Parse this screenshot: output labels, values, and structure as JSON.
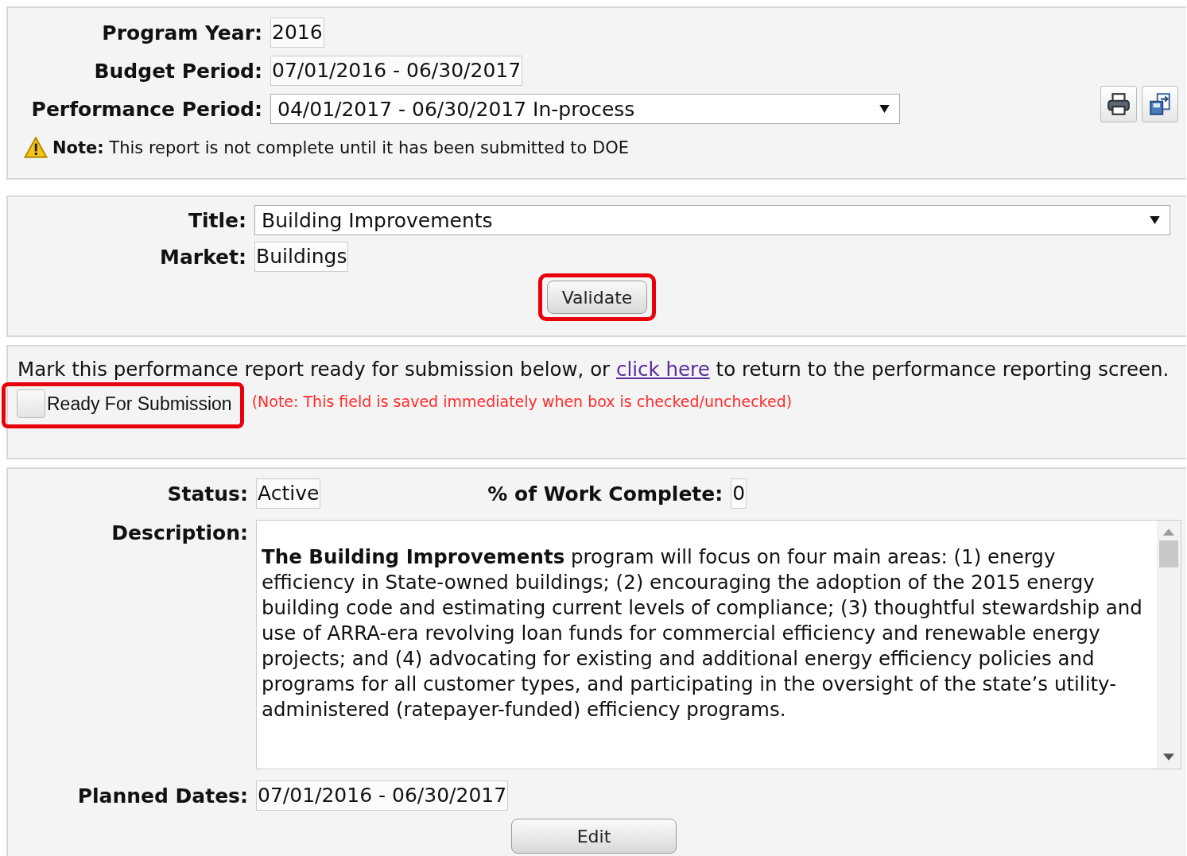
{
  "header": {
    "fields": [
      {
        "label": "Program Year:",
        "value": "2016",
        "kind": "text"
      },
      {
        "label": "Budget Period:",
        "value": "07/01/2016 - 06/30/2017",
        "kind": "text"
      },
      {
        "label": "Performance Period:",
        "value": "04/01/2017 - 06/30/2017 In-process",
        "kind": "select"
      }
    ],
    "note": {
      "label": "Note:",
      "text": "This report is not complete until it has been submitted to DOE"
    }
  },
  "program": {
    "fields": [
      {
        "label": "Title:",
        "value": "Building Improvements",
        "kind": "select"
      },
      {
        "label": "Market:",
        "value": "Buildings",
        "kind": "text"
      }
    ],
    "validate_button": {
      "label": "Validate",
      "highlighted": true
    }
  },
  "submission": {
    "text_before": "Mark this performance report ready for submission below, or ",
    "link": "click here",
    "text_after": " to return to the performance reporting screen.",
    "checkbox": {
      "label": "Ready For Submission",
      "checked": false,
      "highlighted": true
    },
    "note": "(Note: This field is saved immediately when box is checked/unchecked)"
  },
  "details": {
    "status_label": "Status:",
    "status": "Active",
    "percent_label": "% of Work Complete:",
    "percent": "0",
    "description_label": "Description:",
    "description": "**The Building Improvements** program will focus on four main areas: (1) energy efficiency in State-owned buildings; (2) encouraging the adoption of the 2015 energy building code and estimating current levels of compliance; (3) thoughtful stewardship and use of ARRA-era revolving loan funds for commercial efficiency and renewable energy projects; and (4) advocating for existing and additional energy efficiency policies and programs for all customer types, and participating in the oversight of the state’s utility-administered (ratepayer-funded) efficiency programs.",
    "planned_label": "Planned Dates:",
    "planned": "07/01/2016 - 06/30/2017",
    "edit_button": "Edit"
  }
}
